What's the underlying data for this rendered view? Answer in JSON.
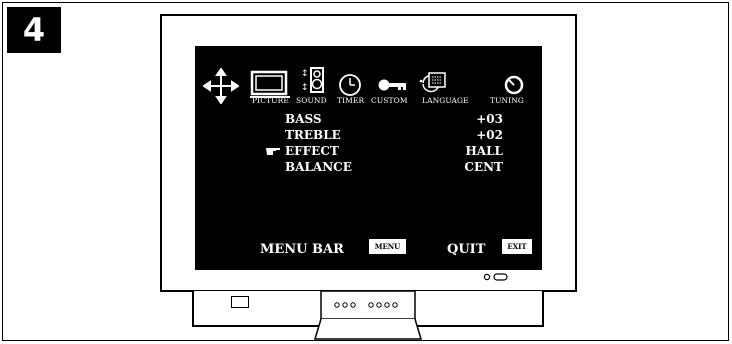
{
  "step": {
    "number": "4"
  },
  "tv": {
    "menu_icons": [
      {
        "name": "move-arrows-icon",
        "label": ""
      },
      {
        "name": "picture-icon",
        "label": "PICTURE"
      },
      {
        "name": "sound-icon",
        "label": "SOUND"
      },
      {
        "name": "timer-icon",
        "label": "TIMER"
      },
      {
        "name": "custom-icon",
        "label": "CUSTOM"
      },
      {
        "name": "language-icon",
        "label": "LANGUAGE"
      },
      {
        "name": "tuning-icon",
        "label": "TUNING"
      }
    ],
    "settings": [
      {
        "label": "BASS",
        "value": "+03",
        "selected": false
      },
      {
        "label": "TREBLE",
        "value": "+02",
        "selected": false
      },
      {
        "label": "EFFECT",
        "value": "HALL",
        "selected": true
      },
      {
        "label": "BALANCE",
        "value": "CENT",
        "selected": false
      }
    ],
    "footer": {
      "menu_bar_label": "MENU BAR",
      "menu_button": "MENU",
      "quit_label": "QUIT",
      "exit_button": "EXIT"
    },
    "colors": {
      "screen": "#000000",
      "text": "#ffffff",
      "bezel": "#ffffff",
      "outline": "#000000"
    }
  }
}
